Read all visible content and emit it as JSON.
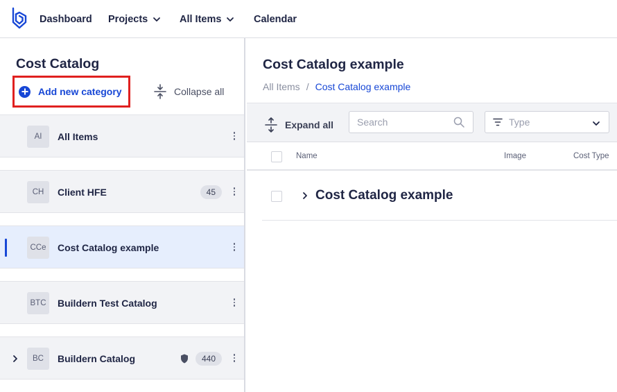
{
  "nav": {
    "logo_icon": "buildern-logo-icon",
    "items": [
      {
        "label": "Dashboard",
        "has_dropdown": false
      },
      {
        "label": "Projects",
        "has_dropdown": true
      },
      {
        "label": "All Items",
        "has_dropdown": true
      },
      {
        "label": "Calendar",
        "has_dropdown": false
      }
    ]
  },
  "sidebar": {
    "title": "Cost Catalog",
    "add_category_label": "Add new category",
    "collapse_all_label": "Collapse all",
    "categories": [
      {
        "abbr": "AI",
        "name": "All Items",
        "count": "",
        "selected": false,
        "expandable": false,
        "shield": false
      },
      {
        "abbr": "CH",
        "name": "Client HFE",
        "count": "45",
        "selected": false,
        "expandable": false,
        "shield": false
      },
      {
        "abbr": "CCe",
        "name": "Cost Catalog example",
        "count": "",
        "selected": true,
        "expandable": false,
        "shield": false
      },
      {
        "abbr": "BTC",
        "name": "Buildern Test Catalog",
        "count": "",
        "selected": false,
        "expandable": false,
        "shield": false
      },
      {
        "abbr": "BC",
        "name": "Buildern Catalog",
        "count": "440",
        "selected": false,
        "expandable": true,
        "shield": true
      }
    ]
  },
  "main": {
    "title": "Cost Catalog example",
    "breadcrumb": {
      "root": "All Items",
      "separator": "/",
      "current": "Cost Catalog example"
    },
    "toolbar": {
      "expand_all_label": "Expand all",
      "search_placeholder": "Search",
      "type_placeholder": "Type"
    },
    "table": {
      "columns": {
        "name": "Name",
        "image": "Image",
        "cost_type": "Cost Type"
      },
      "rows": [
        {
          "name": "Cost Catalog example"
        }
      ]
    }
  },
  "colors": {
    "accent": "#1747d6",
    "highlight_border": "#e0201f",
    "text_primary": "#1f2544",
    "row_bg": "#f2f3f6",
    "selected_bg": "#e6eefd"
  }
}
